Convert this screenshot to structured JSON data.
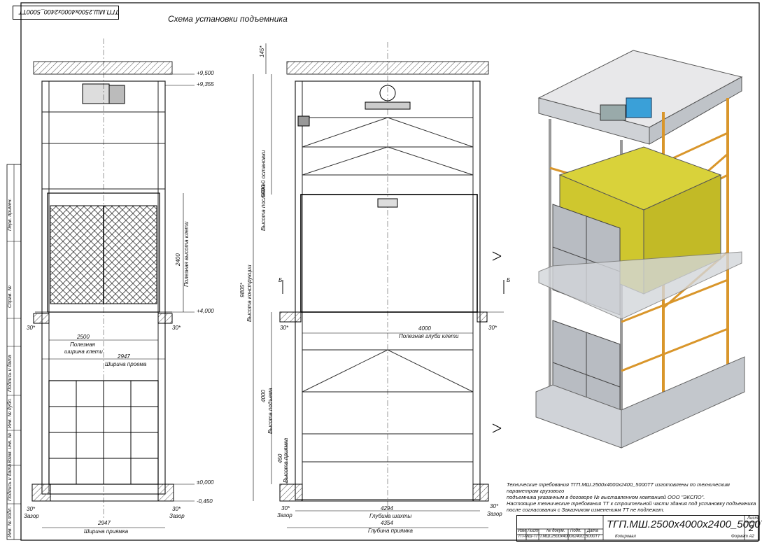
{
  "sheet": {
    "title": "Схема установки подъемника",
    "stamp_code": "ТГП.МШ.2500x4000x2400_5000ТТ",
    "designation": "ТГП.МШ.2500x4000x2400_5000ТТ",
    "sheet_label": "Лист",
    "sheet_number": "2",
    "small_code": "ТП-МШ-ТГП.МШ.2500x4000x2400_5000ТТ",
    "copied": "Копировал",
    "format": "Формат A2"
  },
  "title_block_headers": [
    "Изм.",
    "Лист",
    "№ докум.",
    "Подп.",
    "Дата"
  ],
  "side_columns": [
    "Перв. примен.",
    "Справ. №",
    "Подпись и дата",
    "Инв. № дубл.",
    "Взам. инв. №",
    "Подпись и дата",
    "Инв. № подл."
  ],
  "notes": [
    "Технические требования ТГП.МШ.2500х4000х2400_5000ТТ изготовлены по техническим параметрам грузового",
    "подъемника указанным в договоре №  выставленном компанией ООО \"ЭКСПО\".",
    "Настоящие технические требования ТТ к строительной части здания под установку подъемника",
    "после согласования с Заказчиком изменениям ТТ не подлежат."
  ],
  "front_view": {
    "level_top": "+9,500",
    "level_beam": "+9,355",
    "level_floor2": "+4,000",
    "level_zero": "±0,000",
    "level_pit": "-0,450",
    "gap_left": "30*",
    "gap_right": "30*",
    "gap_bottom_left": "30*",
    "gap_bottom_right": "30*",
    "zazor_left": "Зазор",
    "zazor_right": "Зазор",
    "cab_width": "2500",
    "cab_width_label_1": "Полезная",
    "cab_width_label_2": "ширина клети",
    "opening_width": "2947",
    "opening_width_label": "Ширина проема",
    "pit_width": "2947",
    "pit_width_label": "Ширина приямка",
    "cab_height": "2400",
    "cab_height_label": "Полезная высота клети"
  },
  "side_view": {
    "top_dim": "145*",
    "last_stop_height": "5500",
    "last_stop_label": "Высота последней остановки",
    "construction_height": "9805*",
    "construction_label": "Высота конструкции",
    "lift_height": "4000",
    "lift_label": "Высота подъема",
    "pit_depth": "450",
    "pit_label": "Высота приямка",
    "cab_depth": "4000",
    "cab_depth_label": "Полезная глуби клети",
    "shaft_depth": "4294",
    "shaft_depth_label": "Глубина шахты",
    "pit_length": "4354",
    "pit_length_label": "Глубина приямка",
    "gap_a": "30*",
    "gap_b": "30*",
    "gap_c": "30*",
    "gap_d": "30*",
    "zazor_a": "Зазор",
    "zazor_b": "Зазор",
    "section_mark_left": "Б",
    "section_mark_right": "Б"
  }
}
